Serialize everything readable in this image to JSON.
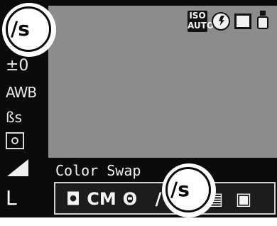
{
  "mode_name": "Color Swap",
  "left_menu": {
    "current_mode_glyph": "∕s",
    "ev_glyph": "±0",
    "awb_label": "AWB",
    "my_colors_glyph": "ßs",
    "size_label": "L"
  },
  "status": {
    "iso_top": "ISO",
    "iso_bottom": "AUTO"
  },
  "mode_bar": {
    "items": [
      {
        "glyph": "◘",
        "icon": "camera-icon"
      },
      {
        "glyph": "CM",
        "icon": "custom-mode-icon"
      },
      {
        "glyph": "Θ",
        "icon": "dial-icon"
      },
      {
        "glyph": "∕",
        "icon": "color-accent-icon"
      },
      {
        "glyph": "∕s",
        "icon": "color-swap-icon"
      },
      {
        "glyph": "▤",
        "icon": "stitch-left-icon"
      },
      {
        "glyph": "▣",
        "icon": "stitch-right-icon"
      }
    ]
  },
  "colors": {
    "screen_bg": "#0b0b0b",
    "preview_bg": "#8c8c8c",
    "highlight": "#ffffff"
  }
}
